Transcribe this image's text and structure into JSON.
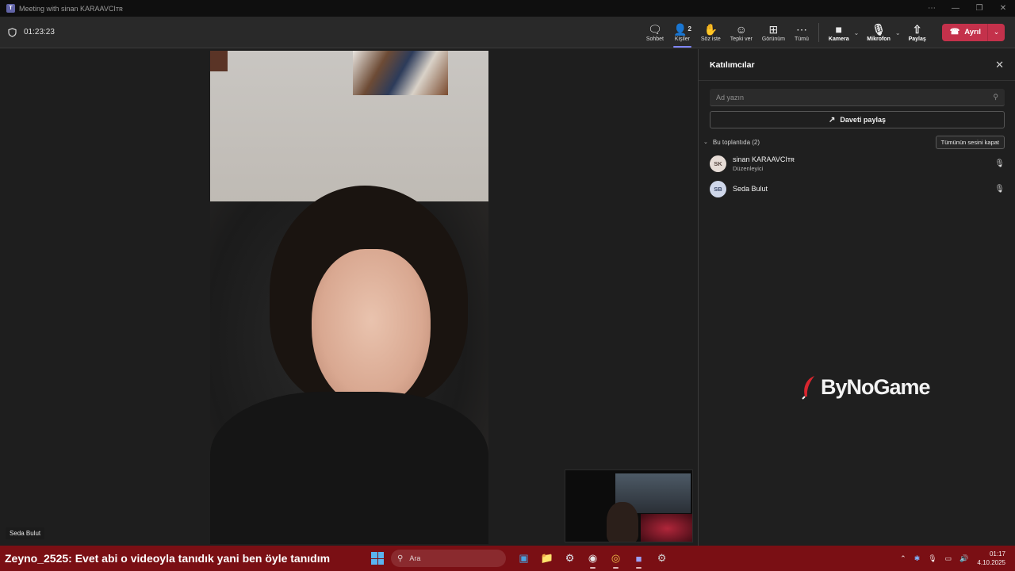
{
  "window": {
    "title": "Meeting with sinan KARAAVCIᴛʀ",
    "buttons": [
      "⋯",
      "—",
      "❐",
      "✕"
    ]
  },
  "toolbar": {
    "timer": "01:23:23",
    "items": [
      {
        "label": "Sohbet",
        "icon": "chat-icon",
        "glyph": "🗨"
      },
      {
        "label": "Kişiler",
        "icon": "people-icon",
        "glyph": "👤",
        "count": "2",
        "active": true
      },
      {
        "label": "Söz iste",
        "icon": "raise-hand-icon",
        "glyph": "✋"
      },
      {
        "label": "Tepki ver",
        "icon": "emoji-icon",
        "glyph": "☺"
      },
      {
        "label": "Görünüm",
        "icon": "view-icon",
        "glyph": "⊞"
      },
      {
        "label": "Tümü",
        "icon": "more-icon",
        "glyph": "⋯"
      }
    ],
    "camera": {
      "label": "Kamera",
      "icon": "camera-icon",
      "glyph": "■"
    },
    "mic": {
      "label": "Mikrofon",
      "icon": "mic-icon",
      "glyph": "🎙"
    },
    "share": {
      "label": "Paylaş",
      "icon": "share-icon",
      "glyph": "⇧"
    },
    "leave": {
      "label": "Ayrıl",
      "icon": "phone-hangup-icon",
      "color": "#c4314b"
    }
  },
  "stage": {
    "participant_name": "Seda Bulut"
  },
  "panel": {
    "title": "Katılımcılar",
    "search_placeholder": "Ad yazın",
    "invite_label": "Daveti paylaş",
    "section_label": "Bu toplantıda (2)",
    "mute_all_label": "Tümünün sesini kapat",
    "participants": [
      {
        "initials": "SK",
        "name": "sinan KARAAVCIᴛʀ",
        "role": "Düzenleyici"
      },
      {
        "initials": "SB",
        "name": "Seda Bulut",
        "role": ""
      }
    ],
    "logo_text": "ByNoGame"
  },
  "taskbar": {
    "chat_user": "Zeyno_2525",
    "chat_message": ": Evet abi o videoyla tanıdık yani ben öyle tanıdım",
    "search_placeholder": "Ara",
    "apps": [
      "photos-icon",
      "file-explorer-icon",
      "steam-icon",
      "obs-icon",
      "chrome-icon",
      "teams-icon",
      "settings-icon"
    ],
    "time": "01:17",
    "date": "4.10.2025",
    "accent": "#7a0f14"
  }
}
